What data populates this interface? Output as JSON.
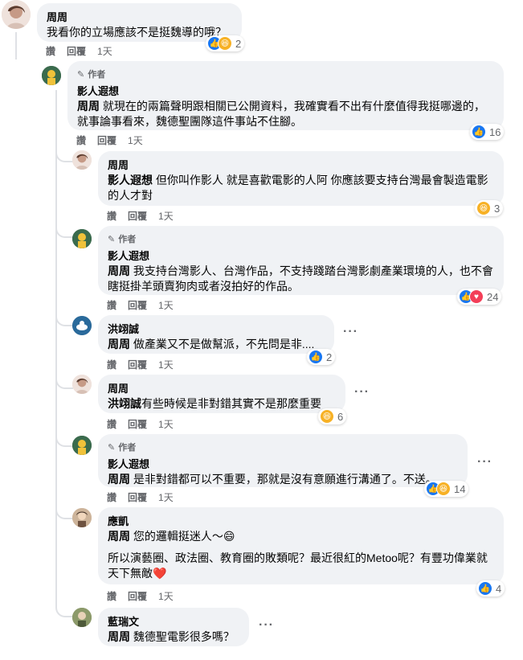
{
  "top": {
    "name": "周周",
    "text": "我看你的立場應該不是挺魏導的哦？",
    "reaction_count": "2",
    "actions": {
      "like": "讚",
      "reply": "回覆",
      "time": "1天"
    }
  },
  "c1": {
    "badge": "作者",
    "name": "影人遐想",
    "mention": "周周",
    "text": " 就現在的兩篇聲明跟相關已公開資料，我確實看不出有什麼值得我挺哪邊的，就事論事看來，魏德聖團隊這件事站不住腳。",
    "reaction_count": "16",
    "actions": {
      "like": "讚",
      "reply": "回覆",
      "time": "1天"
    }
  },
  "c2": {
    "name": "周周",
    "mention": "影人遐想",
    "text": " 但你叫作影人 就是喜歡電影的人阿 你應該要支持台灣最會製造電影的人才對",
    "reaction_count": "3",
    "actions": {
      "like": "讚",
      "reply": "回覆",
      "time": "1天"
    }
  },
  "c3": {
    "badge": "作者",
    "name": "影人遐想",
    "mention": "周周",
    "text": " 我支持台灣影人、台灣作品，不支持踐踏台灣影劇產業環境的人，也不會瞎挺掛羊頭賣狗肉或者沒拍好的作品。",
    "reaction_count": "24",
    "actions": {
      "like": "讚",
      "reply": "回覆",
      "time": "1天"
    }
  },
  "c4": {
    "name": "洪翊誠",
    "mention": "周周",
    "text": " 做產業又不是做幫派，不先問是非....",
    "reaction_count": "2",
    "actions": {
      "like": "讚",
      "reply": "回覆",
      "time": "1天"
    }
  },
  "c5": {
    "name": "周周",
    "mention": "洪翊誠",
    "text": "有些時候是非對錯其實不是那麼重要",
    "reaction_count": "6",
    "actions": {
      "like": "讚",
      "reply": "回覆",
      "time": "1天"
    }
  },
  "c6": {
    "badge": "作者",
    "name": "影人遐想",
    "mention": "周周",
    "text": " 是非對錯都可以不重要，那就是沒有意願進行溝通了。不送。",
    "reaction_count": "14",
    "actions": {
      "like": "讚",
      "reply": "回覆",
      "time": "1天"
    }
  },
  "c7": {
    "name": "應凱",
    "mention": "周周",
    "text": " 您的邏輯挺迷人～😄",
    "text2": "所以演藝圈、政法圈、教育圈的敗類呢？最近很紅的Metoo呢？有豐功偉業就天下無敵❤️",
    "reaction_count": "4",
    "actions": {
      "like": "讚",
      "reply": "回覆",
      "time": "1天"
    }
  },
  "c8": {
    "name": "藍瑞文",
    "mention": "周周",
    "text": " 魏德聖電影很多嗎？"
  },
  "colors": {
    "like": "#1877f2",
    "haha": "#f7b125",
    "love": "#f33e58",
    "bubble": "#f0f2f5"
  }
}
